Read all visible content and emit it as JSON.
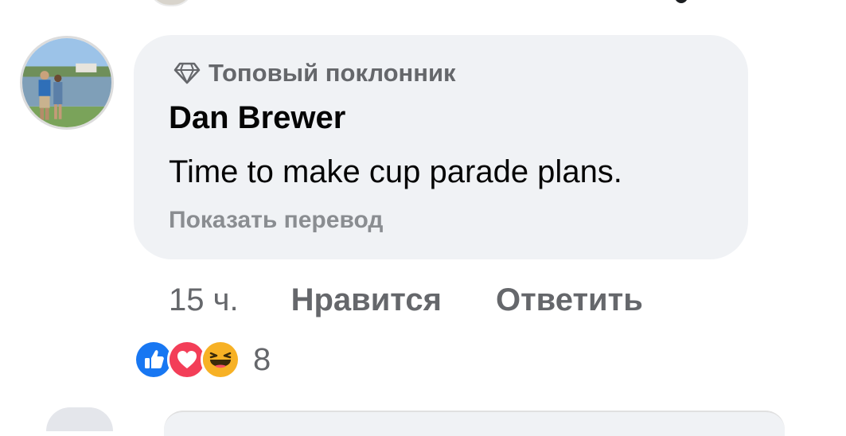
{
  "comment": {
    "badge_label": "Топовый поклонник",
    "badge_icon": "diamond-icon",
    "author": "Dan Brewer",
    "text": "Time to make cup parade plans.",
    "translate_label": "Показать перевод",
    "timestamp": "15 ч.",
    "like_label": "Нравится",
    "reply_label": "Ответить",
    "reactions": {
      "types": [
        "like-icon",
        "love-icon",
        "haha-icon"
      ],
      "count": "8"
    }
  },
  "colors": {
    "bubble_bg": "#f0f2f5",
    "secondary_text": "#65676b",
    "like_blue": "#1877f2",
    "love_red": "#f33e58",
    "haha_yellow": "#f7b125"
  }
}
